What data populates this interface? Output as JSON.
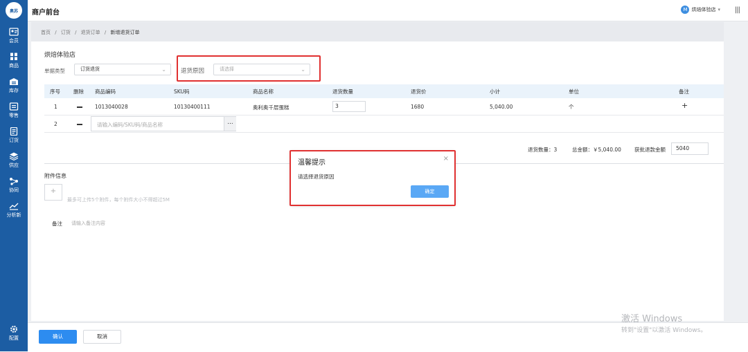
{
  "app": {
    "title": "商户前台",
    "logo_text": "奥苏",
    "store_name": "烘焙体验店",
    "store_avatar": "M",
    "menu_glyph": "|||"
  },
  "sidebar": {
    "items": [
      {
        "label": "会员",
        "icon": "member-card-icon"
      },
      {
        "label": "商品",
        "icon": "grid-icon"
      },
      {
        "label": "库存",
        "icon": "inventory-icon"
      },
      {
        "label": "零售",
        "icon": "retail-icon"
      },
      {
        "label": "订货",
        "icon": "order-icon"
      },
      {
        "label": "供应",
        "icon": "layers-icon"
      },
      {
        "label": "协同",
        "icon": "collaborate-icon"
      },
      {
        "label": "分析新",
        "icon": "chart-icon"
      }
    ],
    "config_label": "配置"
  },
  "breadcrumb": {
    "items": [
      "首页",
      "订货",
      "退货订单",
      "新增退货订单"
    ],
    "separator": "/"
  },
  "form": {
    "shop_name": "烘焙体验店",
    "doc_type_label": "单据类型",
    "doc_type_value": "订货退货",
    "reason_label": "退货原因",
    "reason_placeholder": "请选择"
  },
  "table": {
    "headers": [
      "序号",
      "删除",
      "商品编码",
      "SKU码",
      "商品名称",
      "退货数量",
      "退货价",
      "小计",
      "单位",
      "备注"
    ],
    "rows": [
      {
        "index": "1",
        "code": "1013040028",
        "sku": "10130400111",
        "name": "奥利奥千层蛋糕",
        "qty": "3",
        "price": "1680",
        "subtotal": "5,040.00",
        "unit": "个",
        "note": "+"
      },
      {
        "index": "2",
        "placeholder": "请输入编码/SKU码/商品名称",
        "dots": "..."
      }
    ]
  },
  "summary": {
    "qty_text": "退货数量：3",
    "total_text": "总金额：￥5,040.00",
    "refund_label": "获批退款金额",
    "refund_value": "5040"
  },
  "attachment": {
    "title": "附件信息",
    "hint": "最多可上传5个附件，每个附件大小不得超过5M",
    "add": "+"
  },
  "remark": {
    "label": "备注",
    "placeholder": "请输入备注内容"
  },
  "footer": {
    "confirm": "确认",
    "cancel": "取消"
  },
  "dialog": {
    "title": "温馨提示",
    "message": "请选择退货原因",
    "ok": "确定",
    "close": "×"
  },
  "watermark": {
    "line1": "激活 Windows",
    "line2": "转到\"设置\"以激活 Windows。"
  },
  "colors": {
    "sidebar": "#1c5da3",
    "primary": "#2d8cf0",
    "highlight": "#e03030"
  }
}
